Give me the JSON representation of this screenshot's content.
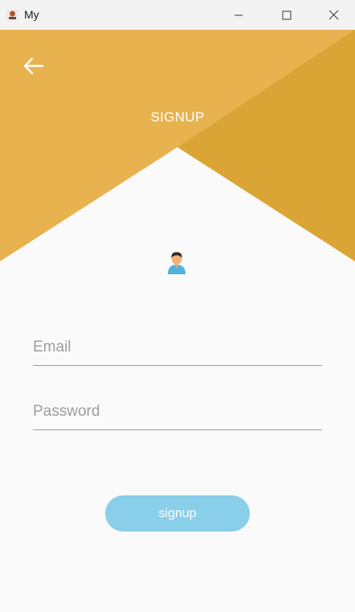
{
  "window": {
    "title": "My"
  },
  "header": {
    "title": "SIGNUP",
    "back_icon": "arrow-left-icon",
    "colors": {
      "light": "#e8b24f",
      "dark": "#dba536",
      "background": "#fafafa"
    }
  },
  "avatar": {
    "icon": "person-icon"
  },
  "form": {
    "email_placeholder": "Email",
    "password_placeholder": "Password",
    "submit_label": "signup",
    "submit_color": "#89cfea"
  }
}
